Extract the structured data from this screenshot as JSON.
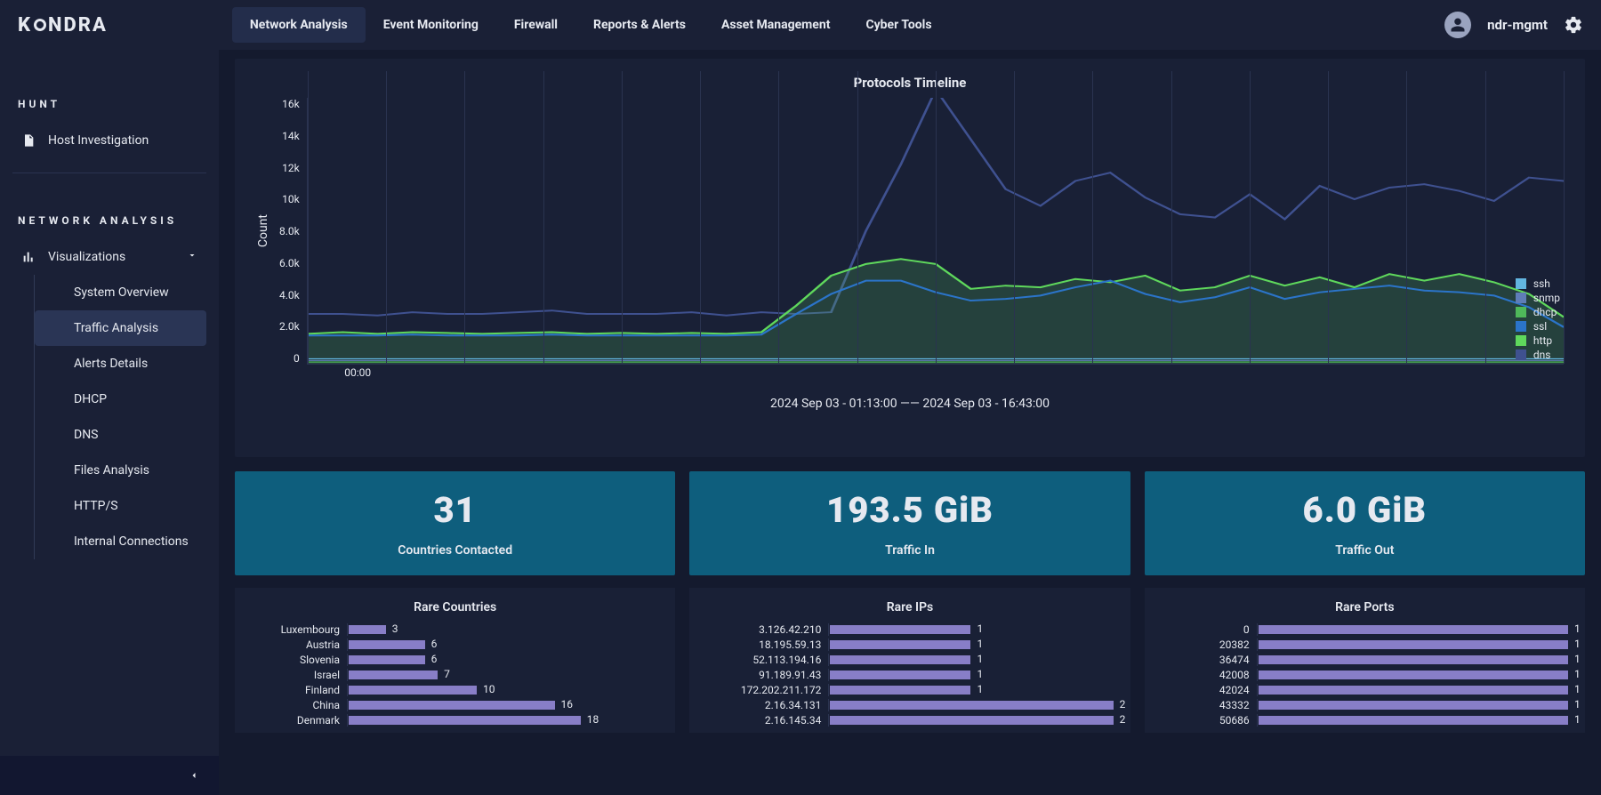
{
  "brand": {
    "part1": "K",
    "part2": "NDRA"
  },
  "top_nav": {
    "items": [
      {
        "label": "Network Analysis",
        "active": true
      },
      {
        "label": "Event Monitoring"
      },
      {
        "label": "Firewall"
      },
      {
        "label": "Reports & Alerts"
      },
      {
        "label": "Asset Management"
      },
      {
        "label": "Cyber Tools"
      }
    ]
  },
  "user": {
    "name": "ndr-mgmt"
  },
  "sidebar": {
    "section_hunt": "HUNT",
    "host_investigation": "Host Investigation",
    "section_na": "NETWORK ANALYSIS",
    "visualizations": "Visualizations",
    "sub_items": [
      {
        "label": "System Overview"
      },
      {
        "label": "Traffic Analysis",
        "active": true
      },
      {
        "label": "Alerts Details"
      },
      {
        "label": "DHCP"
      },
      {
        "label": "DNS"
      },
      {
        "label": "Files Analysis"
      },
      {
        "label": "HTTP/S"
      },
      {
        "label": "Internal Connections"
      }
    ]
  },
  "timeline": {
    "title": "Protocols Timeline",
    "y_label": "Count",
    "y_ticks": [
      "16k",
      "14k",
      "12k",
      "10k",
      "8.0k",
      "6.0k",
      "4.0k",
      "2.0k",
      "0"
    ],
    "x_tick": "00:00",
    "range": "2024 Sep 03 - 01:13:00 —— 2024 Sep 03 - 16:43:00",
    "legend": [
      {
        "name": "ssh",
        "color": "#62b5e0"
      },
      {
        "name": "snmp",
        "color": "#5f7db7"
      },
      {
        "name": "dhcp",
        "color": "#4fb85a"
      },
      {
        "name": "ssl",
        "color": "#2b74c9"
      },
      {
        "name": "http",
        "color": "#5fd85c"
      },
      {
        "name": "dns",
        "color": "#3f5190"
      }
    ]
  },
  "metrics": [
    {
      "value": "31",
      "label": "Countries Contacted"
    },
    {
      "value": "193.5 GiB",
      "label": "Traffic In"
    },
    {
      "value": "6.0 GiB",
      "label": "Traffic Out"
    }
  ],
  "small_charts": {
    "rare_countries": {
      "title": "Rare Countries",
      "max": 24,
      "rows": [
        {
          "label": "Luxembourg",
          "value": 3
        },
        {
          "label": "Austria",
          "value": 6
        },
        {
          "label": "Slovenia",
          "value": 6
        },
        {
          "label": "Israel",
          "value": 7
        },
        {
          "label": "Finland",
          "value": 10
        },
        {
          "label": "China",
          "value": 16
        },
        {
          "label": "Denmark",
          "value": 18
        }
      ]
    },
    "rare_ips": {
      "title": "Rare IPs",
      "max": 2,
      "rows": [
        {
          "label": "3.126.42.210",
          "value": 1
        },
        {
          "label": "18.195.59.13",
          "value": 1
        },
        {
          "label": "52.113.194.16",
          "value": 1
        },
        {
          "label": "91.189.91.43",
          "value": 1
        },
        {
          "label": "172.202.211.172",
          "value": 1
        },
        {
          "label": "2.16.34.131",
          "value": 2
        },
        {
          "label": "2.16.145.34",
          "value": 2
        }
      ]
    },
    "rare_ports": {
      "title": "Rare Ports",
      "max": 1,
      "rows": [
        {
          "label": "0",
          "value": 1
        },
        {
          "label": "20382",
          "value": 1
        },
        {
          "label": "36474",
          "value": 1
        },
        {
          "label": "42008",
          "value": 1
        },
        {
          "label": "42024",
          "value": 1
        },
        {
          "label": "43332",
          "value": 1
        },
        {
          "label": "50686",
          "value": 1
        }
      ]
    }
  },
  "chart_data": [
    {
      "type": "line",
      "title": "Protocols Timeline",
      "ylabel": "Count",
      "ylim": [
        0,
        16000
      ],
      "x_note": "time between 2024-09-03 01:13 and 16:43",
      "series": [
        {
          "name": "dns",
          "color": "#3f5190",
          "values": [
            3000,
            3000,
            2900,
            3100,
            3000,
            3000,
            3100,
            3200,
            3000,
            3000,
            3000,
            3100,
            2900,
            3100,
            3000,
            3100,
            8000,
            12000,
            16500,
            13500,
            10500,
            9500,
            11000,
            11500,
            10000,
            9000,
            8800,
            10200,
            8700,
            10700,
            9900,
            10600,
            10800,
            10400,
            9800,
            11200,
            11000
          ]
        },
        {
          "name": "http",
          "color": "#5fd85c",
          "values": [
            1800,
            1900,
            1800,
            1900,
            1850,
            1800,
            1850,
            1900,
            1800,
            1850,
            1800,
            1850,
            1800,
            1900,
            3500,
            5300,
            6000,
            6300,
            6000,
            4500,
            4700,
            4600,
            5100,
            4900,
            5300,
            4400,
            4600,
            5300,
            4700,
            5200,
            4600,
            5400,
            5000,
            5400,
            4900,
            4200,
            2800
          ]
        },
        {
          "name": "ssl",
          "color": "#2b74c9",
          "values": [
            1700,
            1700,
            1700,
            1750,
            1700,
            1700,
            1700,
            1750,
            1700,
            1700,
            1700,
            1700,
            1700,
            1750,
            3000,
            4200,
            5000,
            5000,
            4300,
            3800,
            3900,
            4100,
            4600,
            5000,
            4200,
            3700,
            4000,
            4600,
            3900,
            4300,
            4500,
            4700,
            4400,
            4300,
            4100,
            3400,
            2200
          ]
        },
        {
          "name": "ssh",
          "color": "#62b5e0",
          "values": [
            300,
            300,
            300,
            300,
            300,
            300,
            300,
            300,
            300,
            300,
            300,
            300,
            300,
            300,
            300,
            300,
            300,
            300,
            300,
            300,
            300,
            300,
            300,
            300,
            300,
            300,
            300,
            300,
            300,
            300,
            300,
            300,
            300,
            300,
            300,
            300,
            300
          ]
        },
        {
          "name": "snmp",
          "color": "#5f7db7",
          "values": [
            200,
            200,
            200,
            200,
            200,
            200,
            200,
            200,
            200,
            200,
            200,
            200,
            200,
            200,
            200,
            200,
            200,
            200,
            200,
            200,
            200,
            200,
            200,
            200,
            200,
            200,
            200,
            200,
            200,
            200,
            200,
            200,
            200,
            200,
            200,
            200,
            200
          ]
        },
        {
          "name": "dhcp",
          "color": "#4fb85a",
          "values": [
            100,
            100,
            100,
            100,
            100,
            100,
            100,
            100,
            100,
            100,
            100,
            100,
            100,
            100,
            100,
            100,
            100,
            100,
            100,
            100,
            100,
            100,
            100,
            100,
            100,
            100,
            100,
            100,
            100,
            100,
            100,
            100,
            100,
            100,
            100,
            100,
            100
          ]
        }
      ]
    },
    {
      "type": "bar",
      "title": "Rare Countries",
      "orientation": "horizontal",
      "categories": [
        "Luxembourg",
        "Austria",
        "Slovenia",
        "Israel",
        "Finland",
        "China",
        "Denmark"
      ],
      "values": [
        3,
        6,
        6,
        7,
        10,
        16,
        18
      ]
    },
    {
      "type": "bar",
      "title": "Rare IPs",
      "orientation": "horizontal",
      "categories": [
        "3.126.42.210",
        "18.195.59.13",
        "52.113.194.16",
        "91.189.91.43",
        "172.202.211.172",
        "2.16.34.131",
        "2.16.145.34"
      ],
      "values": [
        1,
        1,
        1,
        1,
        1,
        2,
        2
      ]
    },
    {
      "type": "bar",
      "title": "Rare Ports",
      "orientation": "horizontal",
      "categories": [
        "0",
        "20382",
        "36474",
        "42008",
        "42024",
        "43332",
        "50686"
      ],
      "values": [
        1,
        1,
        1,
        1,
        1,
        1,
        1
      ]
    }
  ]
}
